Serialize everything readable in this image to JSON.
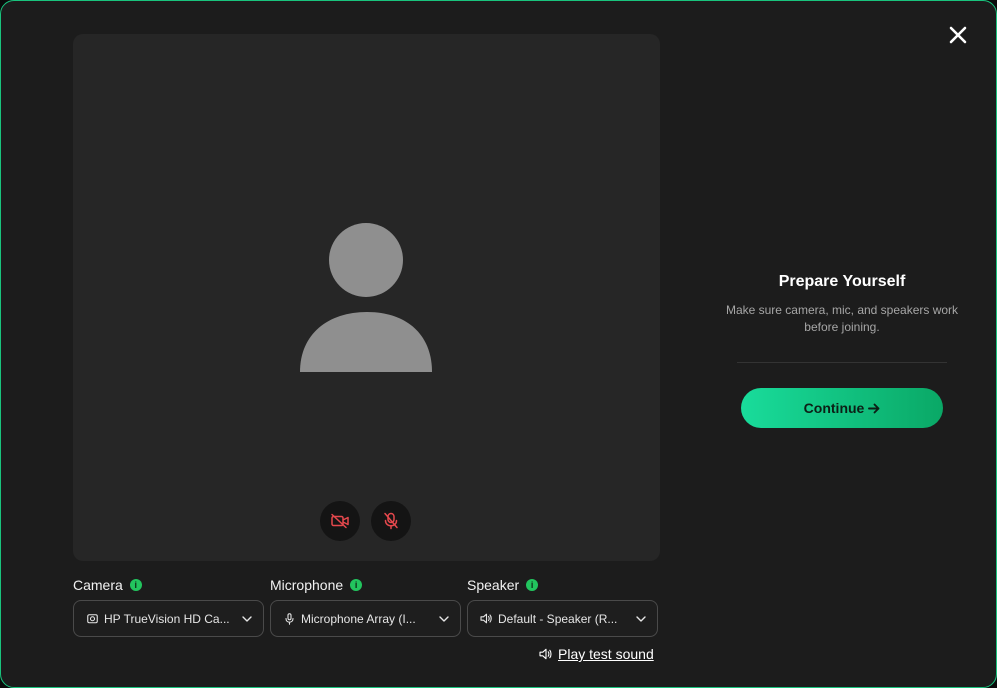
{
  "preview": {
    "camera_toggle_icon": "camera-off-icon",
    "mic_toggle_icon": "mic-off-icon"
  },
  "devices": {
    "camera": {
      "label": "Camera",
      "value": "HP TrueVision HD Ca...",
      "icon": "camera-icon"
    },
    "microphone": {
      "label": "Microphone",
      "value": "Microphone Array (I...",
      "icon": "mic-icon"
    },
    "speaker": {
      "label": "Speaker",
      "value": "Default - Speaker (R...",
      "icon": "speaker-icon"
    },
    "info_badge": "i"
  },
  "test_sound": {
    "label": "Play test sound"
  },
  "side": {
    "title": "Prepare Yourself",
    "description": "Make sure camera, mic, and speakers work before joining.",
    "continue_label": "Continue"
  },
  "colors": {
    "accent": "#19c37d",
    "muted_red": "#e5484d",
    "background": "#1c1c1c",
    "preview_bg": "#262626"
  }
}
